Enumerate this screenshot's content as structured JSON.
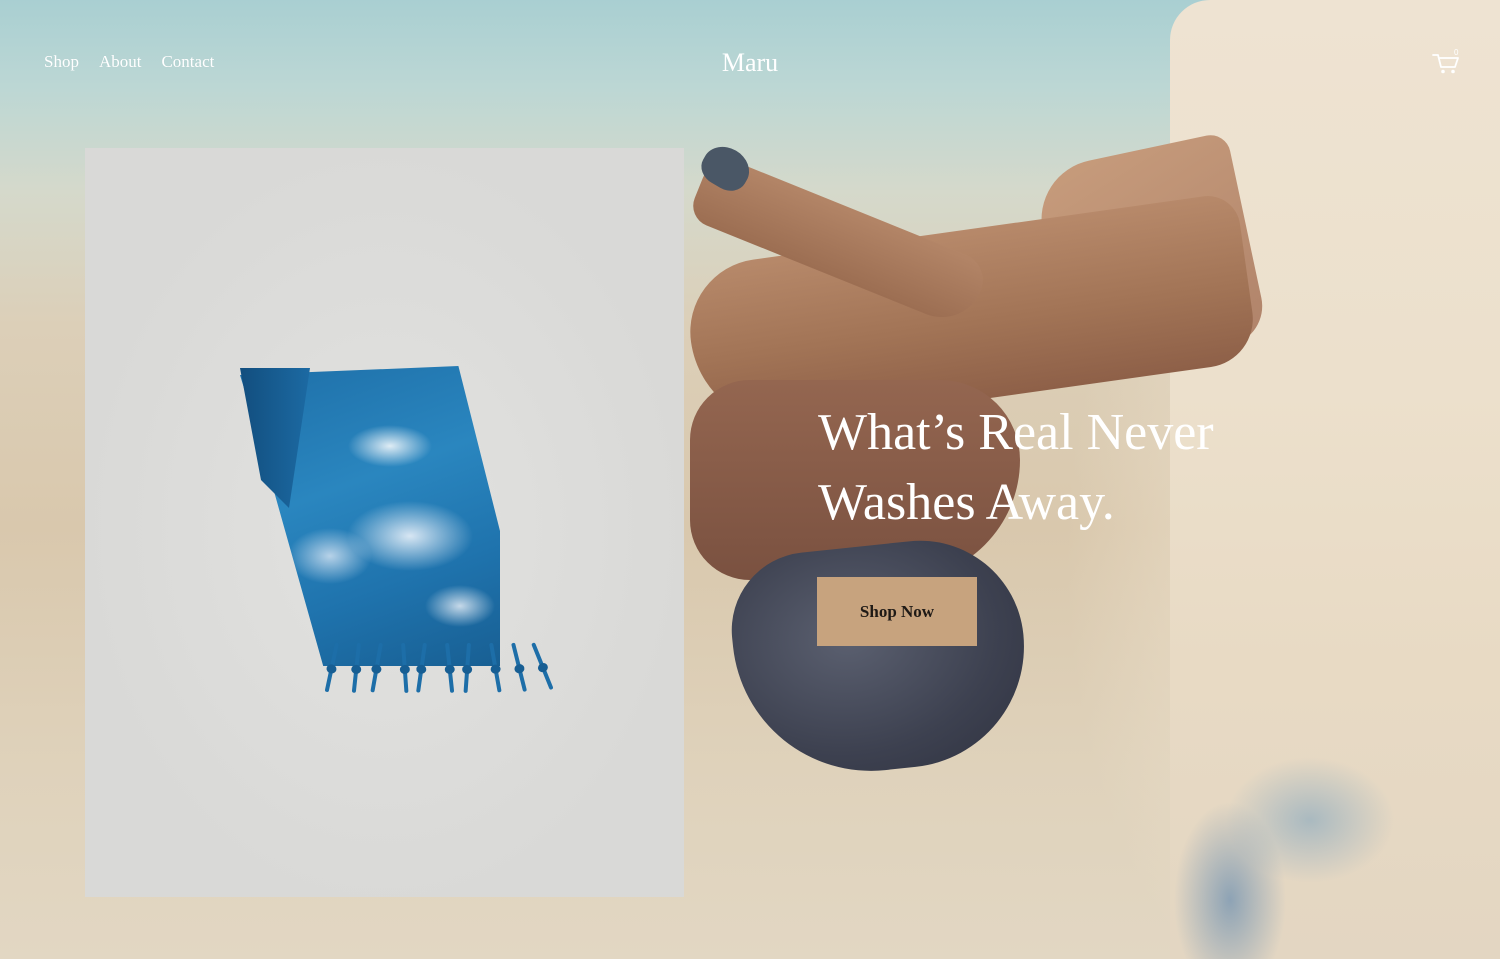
{
  "header": {
    "nav": [
      {
        "label": "Shop"
      },
      {
        "label": "About"
      },
      {
        "label": "Contact"
      }
    ],
    "brand": "Maru",
    "cart": {
      "icon": "cart-icon",
      "count": "0"
    }
  },
  "hero": {
    "headline_line1": "What’s Real Never",
    "headline_line2": "Washes Away.",
    "cta_label": "Shop Now"
  },
  "colors": {
    "cta_background": "#c7a37e",
    "text_light": "#ffffff",
    "product_blue": "#1f73ad"
  }
}
